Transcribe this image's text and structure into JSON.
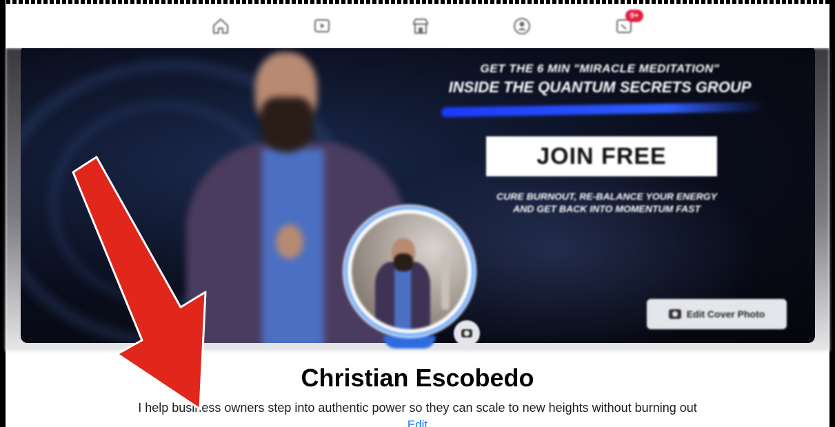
{
  "nav": {
    "items": [
      {
        "name": "home",
        "icon": "home-icon"
      },
      {
        "name": "watch",
        "icon": "video-icon"
      },
      {
        "name": "marketplace",
        "icon": "store-icon"
      },
      {
        "name": "groups",
        "icon": "groups-icon"
      },
      {
        "name": "gaming",
        "icon": "gaming-icon"
      }
    ],
    "badge": "9+"
  },
  "cover": {
    "headline_line1": "GET THE 6 MIN \"MIRACLE MEDITATION\"",
    "headline_line2": "INSIDE THE QUANTUM SECRETS GROUP",
    "join_label": "JOIN FREE",
    "sub_line1": "CURE BURNOUT, RE-BALANCE YOUR ENERGY",
    "sub_line2": "AND GET BACK INTO MOMENTUM FAST",
    "edit_cover_label": "Edit Cover Photo"
  },
  "profile": {
    "name": "Christian Escobedo",
    "bio": "I help business owners step into authentic power so they can scale to new heights without burning out",
    "edit_label": "Edit"
  },
  "colors": {
    "annotation_arrow": "#e1261c",
    "link_blue": "#1877f2",
    "avatar_ring": "#6ea8f7",
    "badge_red": "#e41e3f"
  }
}
